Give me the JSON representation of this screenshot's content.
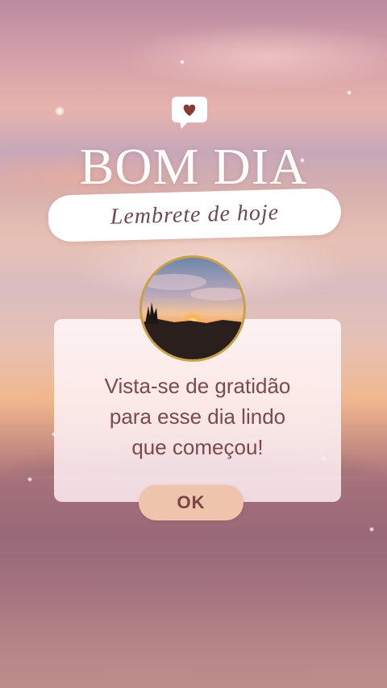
{
  "header": {
    "title": "BOM DIA",
    "subtitle": "Lembrete de hoje",
    "icon": "heart-bubble-icon"
  },
  "card": {
    "image": "sunset-photo",
    "message_lines": [
      "Vista-se de gratidão",
      "para esse dia lindo",
      "que começou!"
    ],
    "button_label": "OK"
  },
  "colors": {
    "accent": "#7a4345",
    "button_bg": "#efc4ad",
    "photo_border": "#c8a24a",
    "heart": "#8a3a35"
  }
}
